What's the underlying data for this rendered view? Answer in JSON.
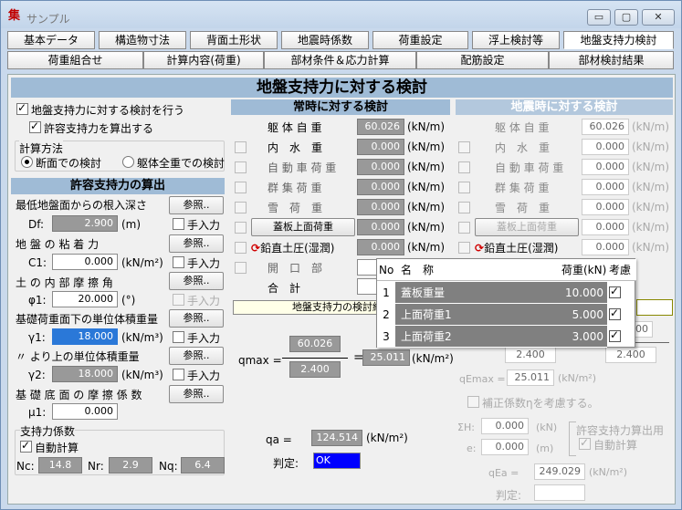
{
  "window": {
    "title": "サンプル",
    "app_icon": "集",
    "minimize": "▭",
    "maximize": "▢",
    "close": "✕"
  },
  "tabs_row1": [
    "基本データ",
    "構造物寸法",
    "背面土形状",
    "地震時係数",
    "荷重設定",
    "浮上検討等",
    "地盤支持力検討"
  ],
  "tabs_row2": [
    "荷重組合せ",
    "計算内容(荷重)",
    "部材条件＆応力計算",
    "配筋設定",
    "部材検討結果"
  ],
  "main_title": "地盤支持力に対する検討",
  "left": {
    "chk_bearing": "地盤支持力に対する検討を行う",
    "chk_allowable": "許容支持力を算出する",
    "method_label": "計算方法",
    "radio_section": "断面での検討",
    "radio_whole": "躯体全重での検討",
    "allowable_header": "許容支持力の算出",
    "depth_label": "最低地盤面からの根入深さ",
    "df_label": "Df:",
    "df_value": "2.900",
    "df_unit": "(m)",
    "cohesion_label": "地 盤 の 粘 着 力",
    "c1_label": "C1:",
    "c1_value": "0.000",
    "c1_unit": "(kN/m²)",
    "friction_label": "土 の 内 部 摩 擦 角",
    "phi_label": "φ1:",
    "phi_value": "20.000",
    "phi_unit": "(°)",
    "weight_below_label": "基礎荷重面下の単位体積重量",
    "g1_label": "γ1:",
    "g1_value": "18.000",
    "g1_unit": "(kN/m³)",
    "weight_above_label": "〃 より上の単位体積重量",
    "g2_label": "γ2:",
    "g2_value": "18.000",
    "g2_unit": "(kN/m³)",
    "base_friction_label": "基 礎 底 面 の 摩 擦 係 数",
    "mu_label": "μ1:",
    "mu_value": "0.000",
    "ref_button": "参照..",
    "manual_input": "手入力",
    "coef_group": "支持力係数",
    "auto_calc": "自動計算",
    "nc_label": "Nc:",
    "nc_value": "14.8",
    "nr_label": "Nr:",
    "nr_value": "2.9",
    "nq_label": "Nq:",
    "nq_value": "6.4"
  },
  "normal": {
    "header": "常時に対する検討",
    "rows": [
      "躯 体 自 重",
      "内　水　重",
      "自 動 車 荷 重",
      "群 集 荷 重",
      "雪　荷　重",
      "蓋板上面荷重",
      "鉛直土圧(湿潤)",
      "開　口　部",
      "合　計"
    ],
    "values": [
      "60.026",
      "0.000",
      "0.000",
      "0.000",
      "0.000",
      "0.000",
      "0.000"
    ],
    "unit": "(kN/m)",
    "result_header": "地盤支持力の検討結果",
    "qmax_label": "qmax =",
    "num": "60.026",
    "den": "2.400",
    "qmax_value": "25.011",
    "qmax_unit": "(kN/m²)",
    "qa_label": "qa =",
    "qa_value": "124.514",
    "qa_unit": "(kN/m²)",
    "judge_label": "判定:",
    "judge_value": "OK"
  },
  "seismic": {
    "header": "地震時に対する検討",
    "rows": [
      "躯 体 自 重",
      "内　水　重",
      "自 動 車 荷 重",
      "群 集 荷 重",
      "雪　荷　重",
      "蓋板上面荷重",
      "鉛直土圧(湿潤)"
    ],
    "values": [
      "60.026",
      "0.000",
      "0.000",
      "0.000",
      "0.000",
      "0.000",
      "0.000"
    ],
    "unit": "(kN/m)",
    "den_left": "2.400",
    "den_right": "2.400",
    "v1": "00",
    "qemax_label": "qEmax =",
    "qemax_value": "25.011",
    "qemax_unit": "(kN/m²)",
    "eta_label": "補正係数ηを考慮する。",
    "sh_label": "ΣH:",
    "sh_value": "0.000",
    "sh_unit": "(kN)",
    "e_label": "e:",
    "e_value": "0.000",
    "e_unit": "(m)",
    "calc_group": "許容支持力算出用",
    "auto_calc": "自動計算",
    "qea_label": "qEa =",
    "qea_value": "249.029",
    "qea_unit": "(kN/m²)",
    "judge_label": "判定:"
  },
  "popup": {
    "headers": [
      "No",
      "名　称",
      "荷重(kN)",
      "考慮"
    ],
    "rows": [
      {
        "no": "1",
        "name": "蓋板重量",
        "load": "10.000",
        "checked": true
      },
      {
        "no": "2",
        "name": "上面荷重1",
        "load": "5.000",
        "checked": true
      },
      {
        "no": "3",
        "name": "上面荷重2",
        "load": "3.000",
        "checked": true
      }
    ]
  }
}
